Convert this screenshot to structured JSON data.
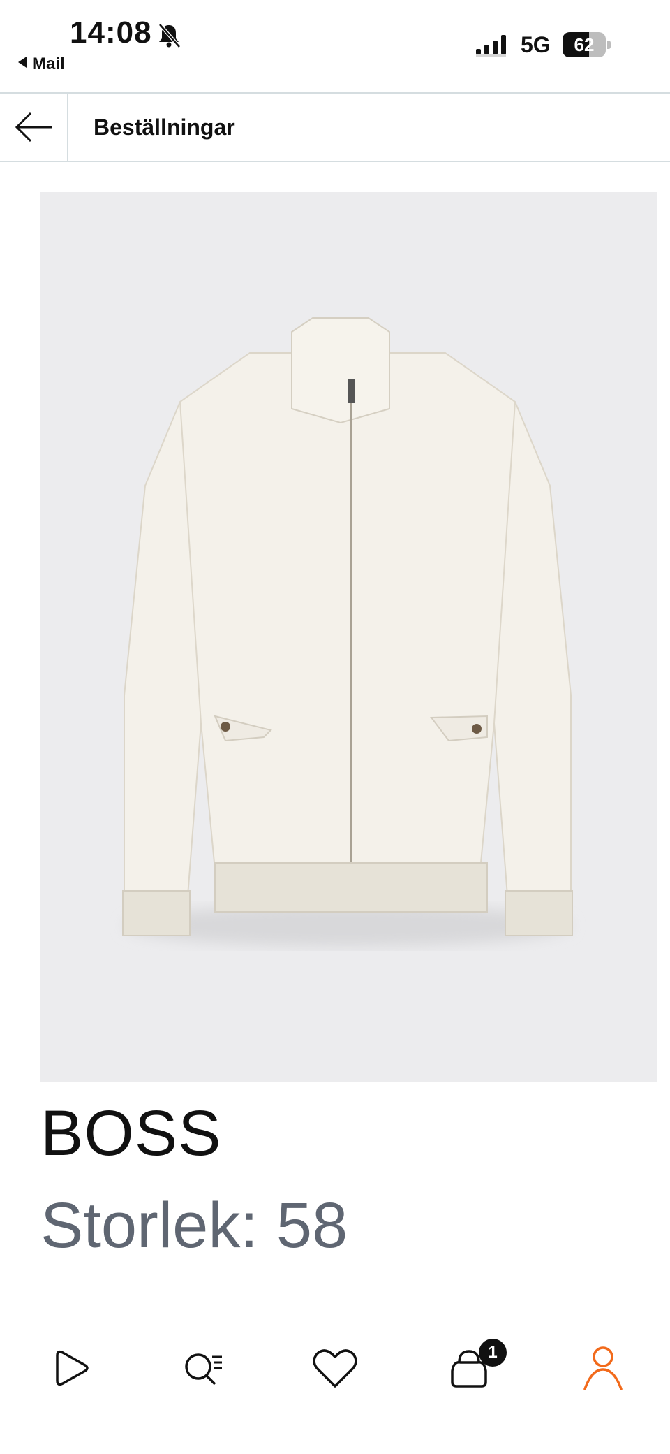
{
  "status_bar": {
    "time": "14:08",
    "back_app": "Mail",
    "network": "5G",
    "battery_level": "62",
    "battery_fraction": 0.62
  },
  "header": {
    "title": "Beställningar"
  },
  "product": {
    "brand": "BOSS",
    "size_label": "Storlek:",
    "size_value": "58"
  },
  "bottom_nav": {
    "items": [
      "play-icon",
      "search-list-icon",
      "heart-icon",
      "bag-icon",
      "profile-icon"
    ],
    "cart_badge": "1",
    "active_color": "#f26a1b"
  }
}
